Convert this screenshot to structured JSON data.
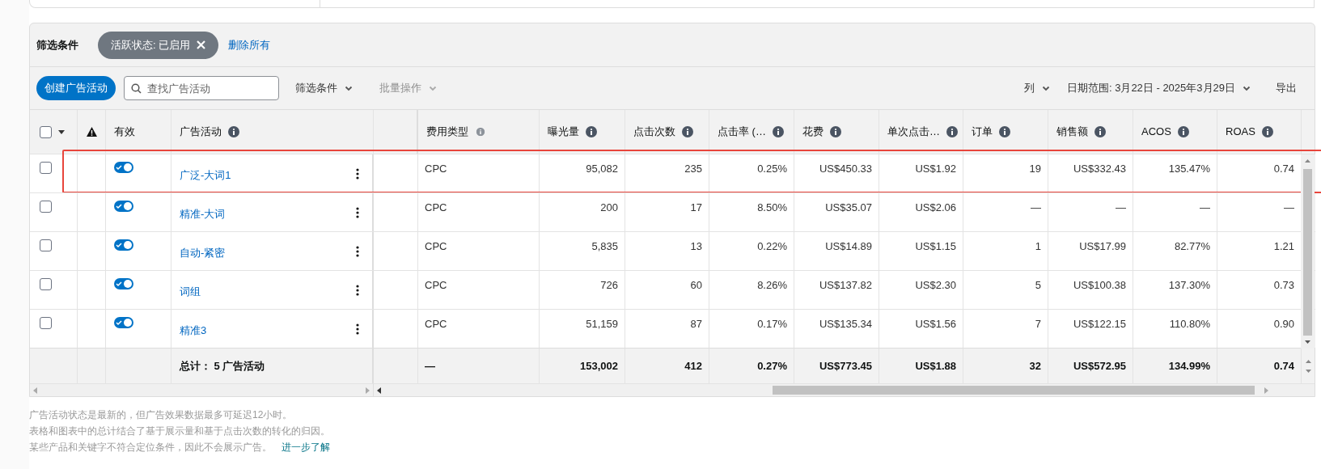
{
  "filter_bar": {
    "label": "筛选条件",
    "chip": "活跃状态: 已启用",
    "clear_link": "删除所有"
  },
  "toolbar": {
    "create_button": "创建广告活动",
    "search": {
      "placeholder": "查找广告活动"
    },
    "filter_menu": {
      "label": "筛选条件",
      "disabled": false
    },
    "bulk_menu": {
      "label": "批量操作",
      "disabled": true
    },
    "columns_menu": "列",
    "date_range": "日期范围: 3月22日 - 2025年3月29日",
    "export": "导出"
  },
  "table": {
    "select_all_checked": false,
    "frozen_columns": [
      {
        "label": "有效",
        "info": false
      },
      {
        "label": "广告活动",
        "info": true
      }
    ],
    "columns": [
      {
        "label": "费用类型",
        "info": true
      },
      {
        "label": "曝光量",
        "info": true
      },
      {
        "label": "点击次数",
        "info": true
      },
      {
        "label": "点击率 (…",
        "info": true
      },
      {
        "label": "花费",
        "info": true
      },
      {
        "label": "单次点击…",
        "info": true
      },
      {
        "label": "订单",
        "info": true
      },
      {
        "label": "销售额",
        "info": true
      },
      {
        "label": "ACOS",
        "info": true
      },
      {
        "label": "ROAS",
        "info": true
      }
    ],
    "rows": [
      {
        "checked": false,
        "enabled": true,
        "highlighted": true,
        "name": "广泛-大词1",
        "cells": [
          "CPC",
          "95,082",
          "235",
          "0.25%",
          "US$450.33",
          "US$1.92",
          "19",
          "US$332.43",
          "135.47%",
          "0.74"
        ]
      },
      {
        "checked": false,
        "enabled": true,
        "highlighted": false,
        "name": "精准-大词",
        "cells": [
          "CPC",
          "200",
          "17",
          "8.50%",
          "US$35.07",
          "US$2.06",
          "—",
          "—",
          "—",
          "—"
        ]
      },
      {
        "checked": false,
        "enabled": true,
        "highlighted": false,
        "name": "自动-紧密",
        "cells": [
          "CPC",
          "5,835",
          "13",
          "0.22%",
          "US$14.89",
          "US$1.15",
          "1",
          "US$17.99",
          "82.77%",
          "1.21"
        ]
      },
      {
        "checked": false,
        "enabled": true,
        "highlighted": false,
        "name": "词组",
        "cells": [
          "CPC",
          "726",
          "60",
          "8.26%",
          "US$137.82",
          "US$2.30",
          "5",
          "US$100.38",
          "137.30%",
          "0.73"
        ]
      },
      {
        "checked": false,
        "enabled": true,
        "highlighted": false,
        "name": "精准3",
        "cells": [
          "CPC",
          "51,159",
          "87",
          "0.17%",
          "US$135.34",
          "US$1.56",
          "7",
          "US$122.15",
          "110.80%",
          "0.90"
        ]
      }
    ],
    "totals": {
      "label": "总计： 5 广告活动",
      "cells": [
        "—",
        "153,002",
        "412",
        "0.27%",
        "US$773.45",
        "US$1.88",
        "32",
        "US$572.95",
        "134.99%",
        "0.74"
      ]
    }
  },
  "notes": [
    "广告活动状态是最新的，但广告效果数据最多可延迟12小时。",
    "表格和图表中的总计结合了基于展示量和基于点击次数的转化的归因。",
    "某些产品和关键字不符合定位条件，因此不会展示广告。"
  ],
  "learn_more_link": "进一步了解"
}
